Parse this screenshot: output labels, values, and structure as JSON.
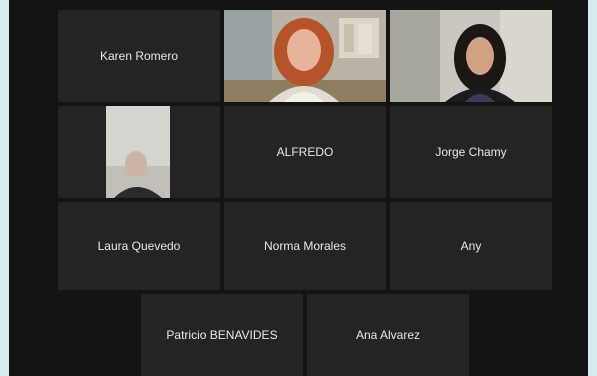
{
  "participants": [
    {
      "name": "Karen Romero"
    },
    {
      "name": "ALFREDO"
    },
    {
      "name": "Jorge Chamy"
    },
    {
      "name": "Laura Quevedo"
    },
    {
      "name": "Norma Morales"
    },
    {
      "name": "Any"
    },
    {
      "name": "Patricio BENAVIDES"
    },
    {
      "name": "Ana Alvarez"
    }
  ],
  "colors": {
    "window_background": "#141414",
    "tile_background": "#242424",
    "name_text": "#e8e8e8",
    "active_speaker_border": "#2ecc71"
  }
}
